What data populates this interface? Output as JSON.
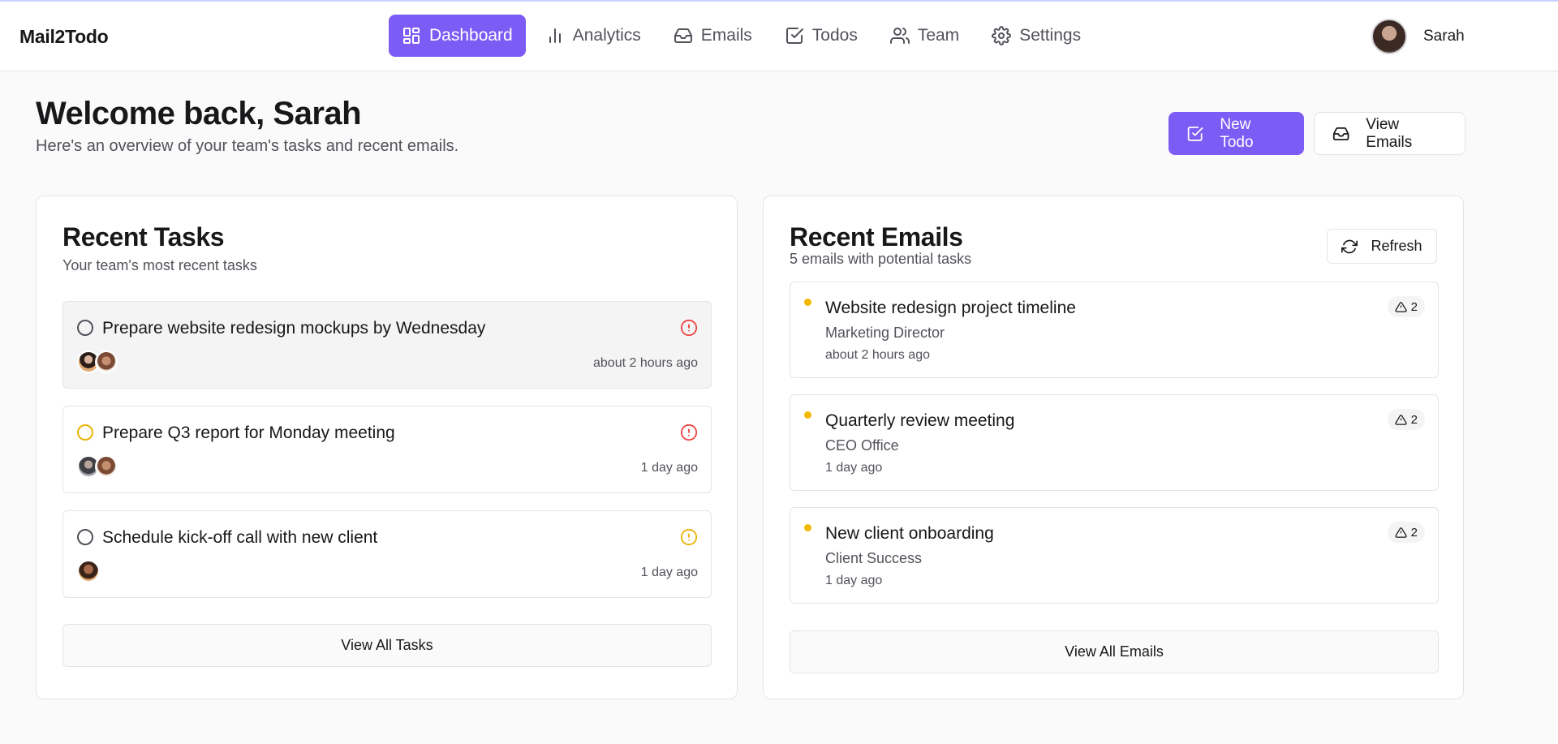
{
  "app": {
    "title": "Mail2Todo"
  },
  "nav": {
    "items": [
      {
        "label": "Dashboard",
        "icon": "dashboard-icon",
        "active": true
      },
      {
        "label": "Analytics",
        "icon": "bar-chart-icon"
      },
      {
        "label": "Emails",
        "icon": "inbox-icon"
      },
      {
        "label": "Todos",
        "icon": "checkbox-icon"
      },
      {
        "label": "Team",
        "icon": "users-icon"
      },
      {
        "label": "Settings",
        "icon": "gear-icon"
      }
    ]
  },
  "user": {
    "name": "Sarah"
  },
  "welcome": {
    "title": "Welcome back, Sarah",
    "subtitle": "Here's an overview of your team's tasks and recent emails."
  },
  "actions": {
    "new_todo": "New Todo",
    "view_emails": "View Emails"
  },
  "tasks": {
    "title": "Recent Tasks",
    "subtitle": "Your team's most recent tasks",
    "items": [
      {
        "title": "Prepare website redesign mockups by Wednesday",
        "time": "about 2 hours ago",
        "priority_color": "#ef4444",
        "status_color": "#52525b"
      },
      {
        "title": "Prepare Q3 report for Monday meeting",
        "time": "1 day ago",
        "priority_color": "#ef4444",
        "status_color": "#eab308"
      },
      {
        "title": "Schedule kick-off call with new client",
        "time": "1 day ago",
        "priority_color": "#eab308",
        "status_color": "#52525b"
      }
    ],
    "view_all": "View All Tasks"
  },
  "emails": {
    "title": "Recent Emails",
    "subtitle": "5 emails with potential tasks",
    "refresh": "Refresh",
    "items": [
      {
        "subject": "Website redesign project timeline",
        "from": "Marketing Director",
        "time": "about 2 hours ago",
        "tasks": "2"
      },
      {
        "subject": "Quarterly review meeting",
        "from": "CEO Office",
        "time": "1 day ago",
        "tasks": "2"
      },
      {
        "subject": "New client onboarding",
        "from": "Client Success",
        "time": "1 day ago",
        "tasks": "2"
      }
    ],
    "view_all": "View All Emails"
  },
  "colors": {
    "accent": "#7c5cf5",
    "warning": "#eab308",
    "danger": "#ef4444",
    "unread_dot": "#f5b800"
  }
}
